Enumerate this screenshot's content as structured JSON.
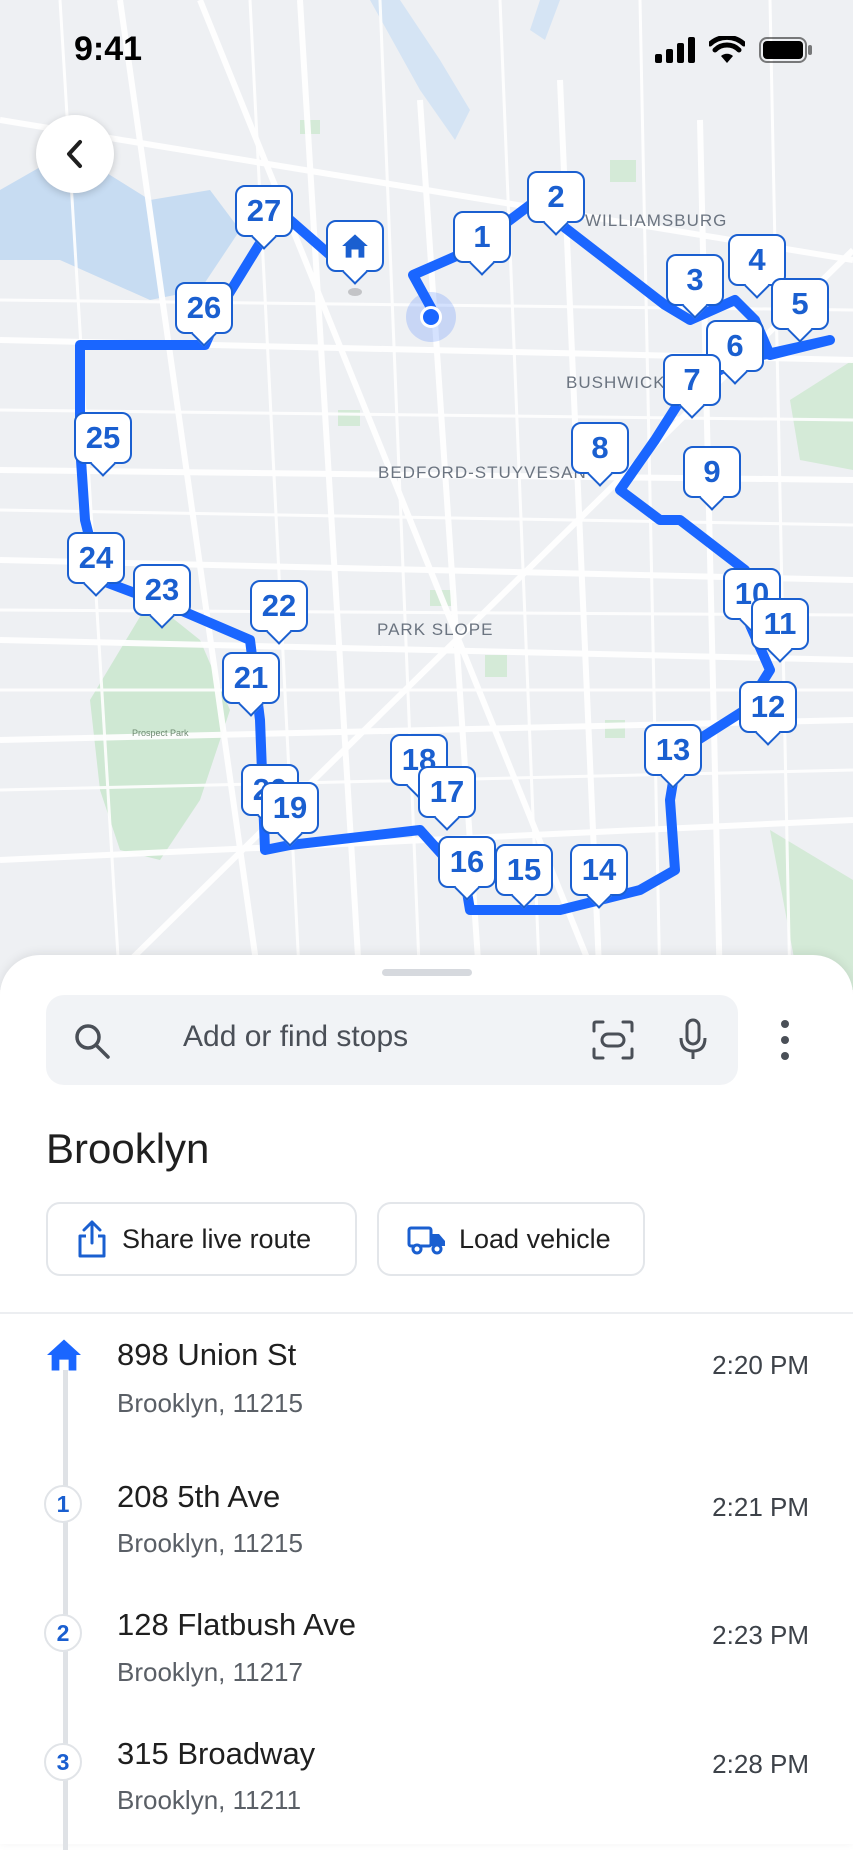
{
  "status_bar": {
    "time": "9:41"
  },
  "map": {
    "neighborhoods": [
      "WILLIAMSBURG",
      "BUSHWICK",
      "BEDFORD-STUYVESANT",
      "PARK SLOPE",
      "Prospect Park"
    ],
    "markers": [
      "1",
      "2",
      "3",
      "4",
      "5",
      "6",
      "7",
      "8",
      "9",
      "10",
      "11",
      "12",
      "13",
      "14",
      "15",
      "16",
      "17",
      "18",
      "19",
      "20",
      "21",
      "22",
      "23",
      "24",
      "25",
      "26",
      "27"
    ],
    "route_color": "#1a66ff"
  },
  "search": {
    "placeholder": "Add or find stops"
  },
  "route": {
    "title": "Brooklyn",
    "actions": {
      "share": "Share live route",
      "load": "Load vehicle"
    }
  },
  "stops": [
    {
      "marker": "home",
      "street": "898 Union St",
      "city": "Brooklyn, 11215",
      "time": "2:20 PM"
    },
    {
      "marker": "1",
      "street": "208 5th Ave",
      "city": "Brooklyn, 11215",
      "time": "2:21 PM"
    },
    {
      "marker": "2",
      "street": "128 Flatbush Ave",
      "city": "Brooklyn, 11217",
      "time": "2:23 PM"
    },
    {
      "marker": "3",
      "street": "315 Broadway",
      "city": "Brooklyn, 11211",
      "time": "2:28 PM"
    }
  ],
  "colors": {
    "accent": "#1a5fd0",
    "route": "#1a66ff",
    "map_bg": "#eef0f3"
  }
}
